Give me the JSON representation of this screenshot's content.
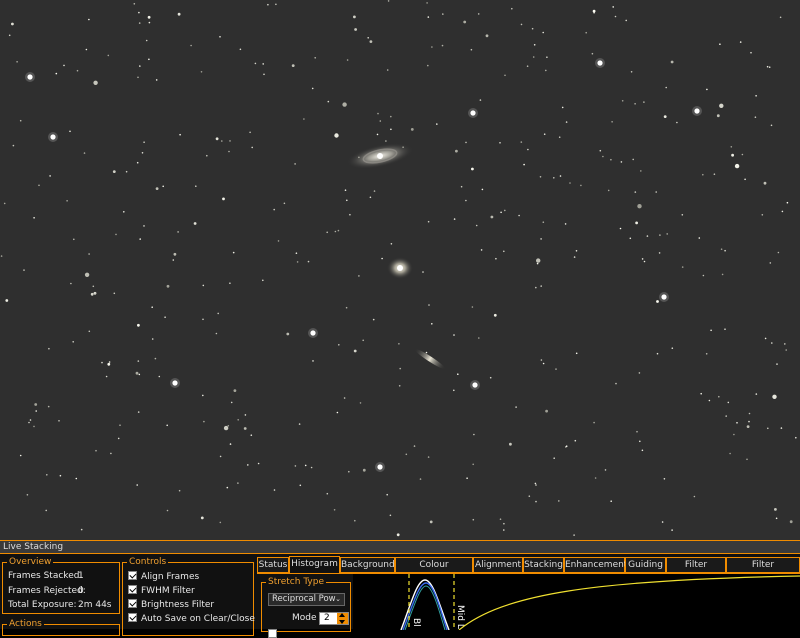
{
  "panel": {
    "title": "Live Stacking",
    "overview": {
      "legend": "Overview",
      "frames_stacked_label": "Frames Stacked:",
      "frames_stacked": "1",
      "frames_rejected_label": "Frames Rejected:",
      "frames_rejected": "0",
      "total_exposure_label": "Total Exposure:",
      "total_exposure": "2m 44s"
    },
    "actions": {
      "legend": "Actions"
    },
    "controls": {
      "legend": "Controls",
      "items": [
        {
          "label": "Align Frames",
          "checked": true
        },
        {
          "label": "FWHM Filter",
          "checked": true
        },
        {
          "label": "Brightness Filter",
          "checked": true
        },
        {
          "label": "Auto Save on Clear/Close",
          "checked": true
        }
      ]
    },
    "tabs": [
      "Status",
      "Histogram",
      "Background",
      "Colour Calibration",
      "Alignment",
      "Stacking",
      "Enhancement",
      "Guiding",
      "Filter (FWHM)",
      "Filter (Brightness)"
    ],
    "active_tab": "Histogram",
    "histogram": {
      "stretch_type_legend": "Stretch Type",
      "stretch_type_value": "Reciprocal Pow",
      "mode_label": "Mode",
      "mode_value": "2",
      "marker_labels": [
        "Bl",
        "Mid L"
      ]
    }
  },
  "colors": {
    "accent": "#f08c00",
    "sky": "#2f2f2f",
    "panel_bg": "#111111",
    "histogram_curve": "#f0e030"
  }
}
